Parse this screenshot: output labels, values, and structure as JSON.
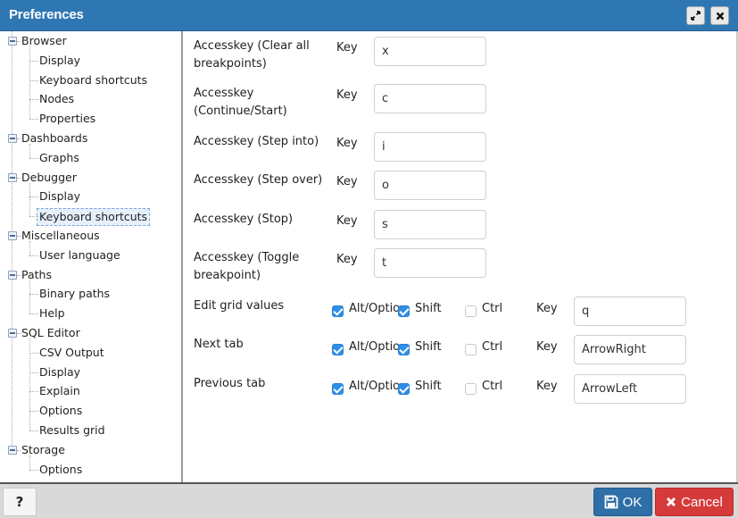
{
  "window": {
    "title": "Preferences",
    "maximize_icon": "expand-arrows-icon",
    "close_icon": "close-x-icon"
  },
  "tree": [
    {
      "label": "Browser",
      "children": [
        "Display",
        "Keyboard shortcuts",
        "Nodes",
        "Properties"
      ]
    },
    {
      "label": "Dashboards",
      "children": [
        "Graphs"
      ]
    },
    {
      "label": "Debugger",
      "children": [
        "Display",
        "Keyboard shortcuts"
      ]
    },
    {
      "label": "Miscellaneous",
      "children": [
        "User language"
      ]
    },
    {
      "label": "Paths",
      "children": [
        "Binary paths",
        "Help"
      ]
    },
    {
      "label": "SQL Editor",
      "children": [
        "CSV Output",
        "Display",
        "Explain",
        "Options",
        "Results grid"
      ]
    },
    {
      "label": "Storage",
      "children": [
        "Options"
      ]
    }
  ],
  "selected": {
    "group": "Debugger",
    "item": "Keyboard shortcuts"
  },
  "accesskeys": [
    {
      "label": "Accesskey (Clear all breakpoints)",
      "key_label": "Key",
      "value": "x"
    },
    {
      "label": "Accesskey (Continue/Start)",
      "key_label": "Key",
      "value": "c"
    },
    {
      "label": "Accesskey (Step into)",
      "key_label": "Key",
      "value": "i"
    },
    {
      "label": "Accesskey (Step over)",
      "key_label": "Key",
      "value": "o"
    },
    {
      "label": "Accesskey (Stop)",
      "key_label": "Key",
      "value": "s"
    },
    {
      "label": "Accesskey (Toggle breakpoint)",
      "key_label": "Key",
      "value": "t"
    }
  ],
  "shortcuts": [
    {
      "label": "Edit grid values",
      "alt_label": "Alt/Option",
      "alt": true,
      "shift_label": "Shift",
      "shift": true,
      "ctrl_label": "Ctrl",
      "ctrl": false,
      "key_label": "Key",
      "value": "q"
    },
    {
      "label": "Next tab",
      "alt_label": "Alt/Option",
      "alt": true,
      "shift_label": "Shift",
      "shift": true,
      "ctrl_label": "Ctrl",
      "ctrl": false,
      "key_label": "Key",
      "value": "ArrowRight"
    },
    {
      "label": "Previous tab",
      "alt_label": "Alt/Option",
      "alt": true,
      "shift_label": "Shift",
      "shift": true,
      "ctrl_label": "Ctrl",
      "ctrl": false,
      "key_label": "Key",
      "value": "ArrowLeft"
    }
  ],
  "footer": {
    "help_label": "?",
    "ok_label": "OK",
    "cancel_label": "Cancel"
  },
  "colors": {
    "titlebar": "#2f77b3",
    "ok": "#2f6fa8",
    "cancel": "#d63a3a",
    "checkbox": "#2e8ee8"
  }
}
